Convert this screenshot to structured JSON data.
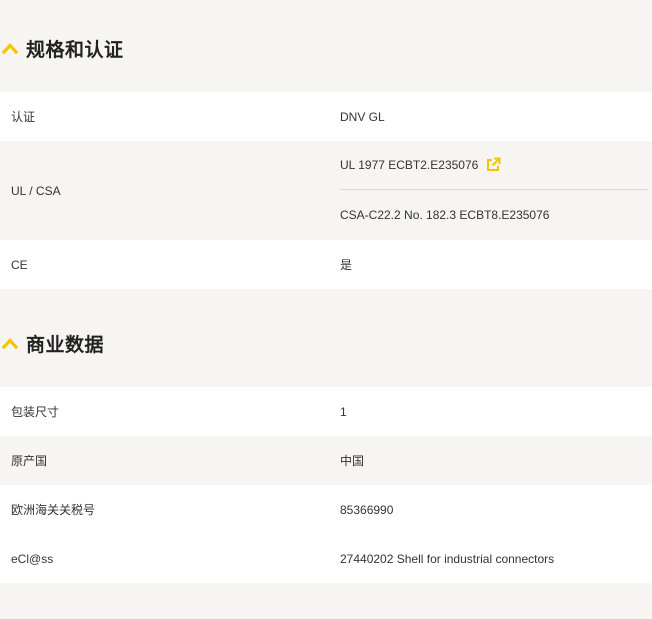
{
  "colors": {
    "accent": "#f5c400",
    "row_white": "#ffffff",
    "row_grey": "#f6f5f2",
    "divider": "#d9d9d9"
  },
  "sections": [
    {
      "title": "规格和认证",
      "icon": "chevron-up-icon",
      "rows": [
        {
          "label": "认证",
          "value": "DNV GL"
        },
        {
          "label": "UL / CSA",
          "values": [
            {
              "text": "UL 1977 ECBT2.E235076",
              "icon": "external-link-icon"
            },
            {
              "text": "CSA-C22.2 No. 182.3 ECBT8.E235076"
            }
          ]
        },
        {
          "label": "CE",
          "value": "是"
        }
      ]
    },
    {
      "title": "商业数据",
      "icon": "chevron-up-icon",
      "rows": [
        {
          "label": "包装尺寸",
          "value": "1"
        },
        {
          "label": "原产国",
          "value": "中国"
        },
        {
          "label": "欧洲海关关税号",
          "value": "85366990"
        },
        {
          "label": "eCl@ss",
          "value": "27440202 Shell for industrial connectors"
        }
      ]
    }
  ]
}
